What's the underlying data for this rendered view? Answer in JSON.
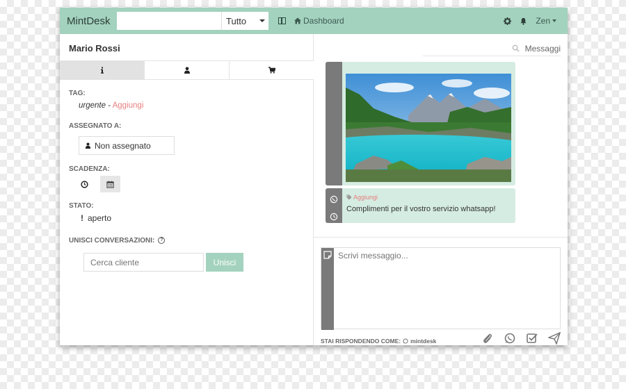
{
  "app": {
    "brand": "MintDesk"
  },
  "topbar": {
    "search_placeholder": "",
    "search_scope": "Tutto",
    "dashboard_label": "Dashboard",
    "user_name": "Zen"
  },
  "contact": {
    "name": "Mario Rossi",
    "tabs": [
      {
        "icon": "info-icon",
        "active": true
      },
      {
        "icon": "user-icon",
        "active": false
      },
      {
        "icon": "cart-icon",
        "active": false
      }
    ],
    "tag_label": "TAG:",
    "tag_value": "urgente",
    "tag_separator": " - ",
    "tag_add": "Aggiungi",
    "assigned_label": "ASSEGNATO A:",
    "assigned_value": "Non assegnato",
    "due_label": "SCADENZA:",
    "state_label": "STATO:",
    "state_mark": "!",
    "state_value": "aperto",
    "merge_label": "UNISCI CONVERSAZIONI:",
    "merge_help": "?",
    "merge_placeholder": "Cerca cliente",
    "merge_button": "Unisci"
  },
  "messages": {
    "search_placeholder": "Messaggi",
    "items": [
      {
        "type": "image",
        "subject": "mountain-lake-photo"
      },
      {
        "type": "text",
        "channel": "whatsapp",
        "tag_add": "Aggiungi",
        "text": "Complimenti per il vostro servizio whatsapp!"
      }
    ]
  },
  "composer": {
    "placeholder": "Scrivi messaggio...",
    "reply_as_label": "STAI RISPONDENDO COME:",
    "reply_as_account": "mintdesk"
  },
  "colors": {
    "accent": "#a3d2be",
    "bubble": "#d5ece2",
    "tag_link": "#e87e7e",
    "strip": "#7a7a7a"
  }
}
